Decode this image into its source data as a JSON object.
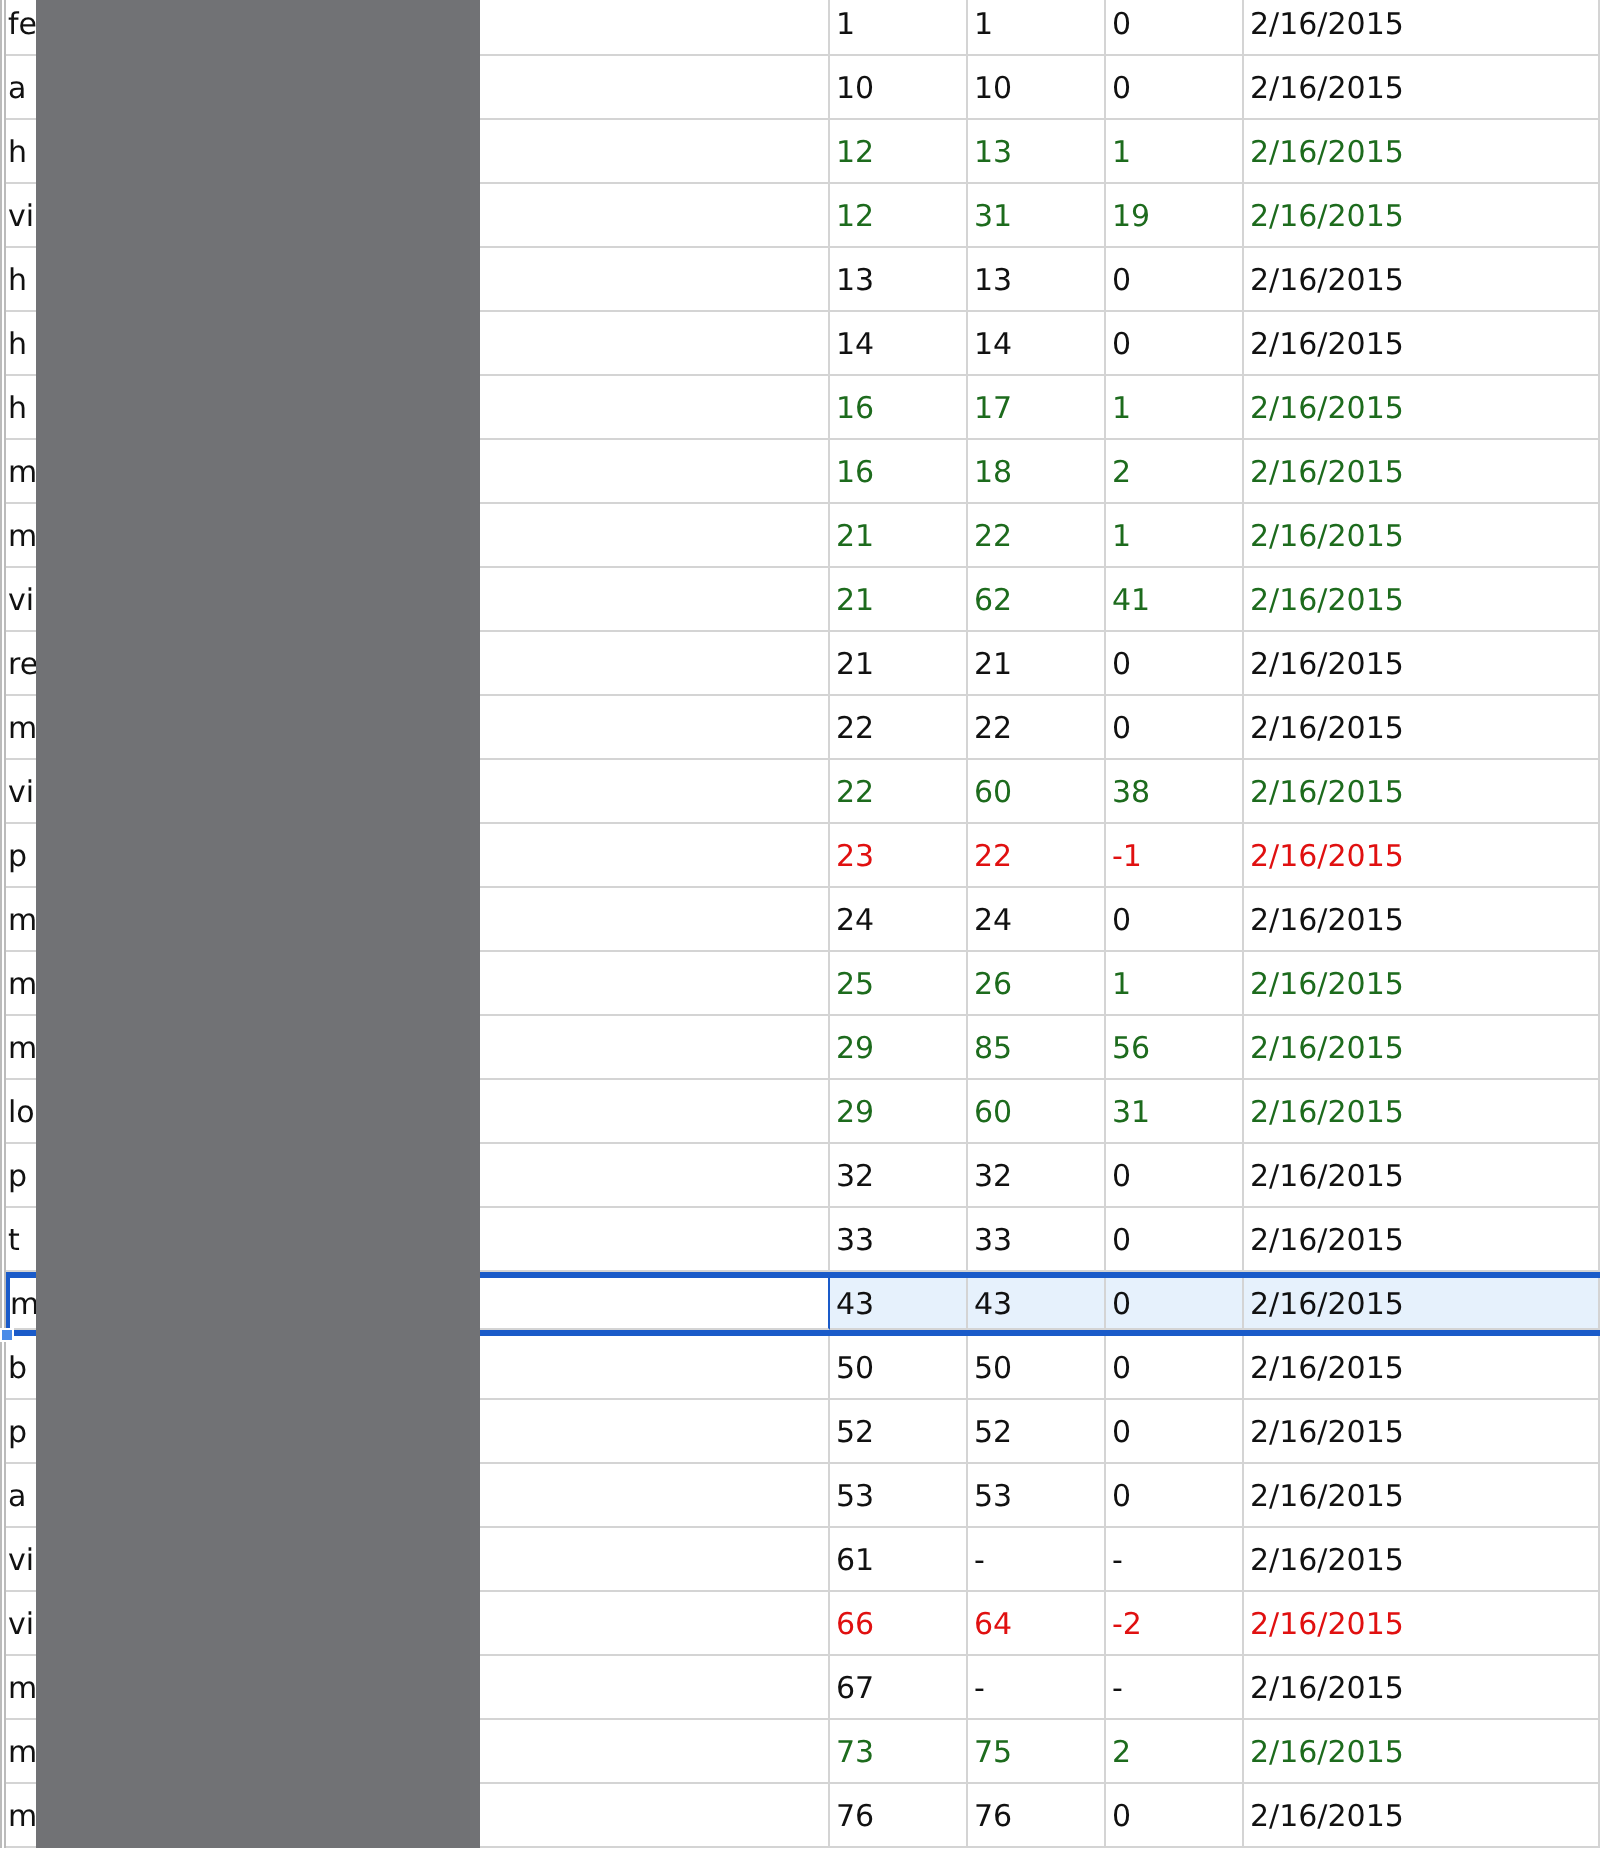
{
  "rows": [
    {
      "label": "fe",
      "column_2": "1",
      "column_3": "1",
      "column_4": "0",
      "column_5": "2/16/2015",
      "color": "#111111",
      "selected": false
    },
    {
      "label": "a",
      "column_2": "10",
      "column_3": "10",
      "column_4": "0",
      "column_5": "2/16/2015",
      "color": "#111111",
      "selected": false
    },
    {
      "label": "h",
      "column_2": "12",
      "column_3": "13",
      "column_4": "1",
      "column_5": "2/16/2015",
      "color": "#1d6b1d",
      "selected": false
    },
    {
      "label": "vi",
      "column_2": "12",
      "column_3": "31",
      "column_4": "19",
      "column_5": "2/16/2015",
      "color": "#1d6b1d",
      "selected": false
    },
    {
      "label": "h",
      "column_2": "13",
      "column_3": "13",
      "column_4": "0",
      "column_5": "2/16/2015",
      "color": "#111111",
      "selected": false
    },
    {
      "label": "h",
      "column_2": "14",
      "column_3": "14",
      "column_4": "0",
      "column_5": "2/16/2015",
      "color": "#111111",
      "selected": false
    },
    {
      "label": "h",
      "column_2": "16",
      "column_3": "17",
      "column_4": "1",
      "column_5": "2/16/2015",
      "color": "#1d6b1d",
      "selected": false
    },
    {
      "label": "m",
      "column_2": "16",
      "column_3": "18",
      "column_4": "2",
      "column_5": "2/16/2015",
      "color": "#1d6b1d",
      "selected": false
    },
    {
      "label": "m",
      "column_2": "21",
      "column_3": "22",
      "column_4": "1",
      "column_5": "2/16/2015",
      "color": "#1d6b1d",
      "selected": false
    },
    {
      "label": "vi",
      "column_2": "21",
      "column_3": "62",
      "column_4": "41",
      "column_5": "2/16/2015",
      "color": "#1d6b1d",
      "selected": false
    },
    {
      "label": "re",
      "column_2": "21",
      "column_3": "21",
      "column_4": "0",
      "column_5": "2/16/2015",
      "color": "#111111",
      "selected": false
    },
    {
      "label": "m",
      "column_2": "22",
      "column_3": "22",
      "column_4": "0",
      "column_5": "2/16/2015",
      "color": "#111111",
      "selected": false
    },
    {
      "label": "vi",
      "column_2": "22",
      "column_3": "60",
      "column_4": "38",
      "column_5": "2/16/2015",
      "color": "#1d6b1d",
      "selected": false
    },
    {
      "label": "p",
      "column_2": "23",
      "column_3": "22",
      "column_4": "-1",
      "column_5": "2/16/2015",
      "color": "#e01010",
      "selected": false
    },
    {
      "label": "m",
      "column_2": "24",
      "column_3": "24",
      "column_4": "0",
      "column_5": "2/16/2015",
      "color": "#111111",
      "selected": false
    },
    {
      "label": "m",
      "column_2": "25",
      "column_3": "26",
      "column_4": "1",
      "column_5": "2/16/2015",
      "color": "#1d6b1d",
      "selected": false
    },
    {
      "label": "m",
      "column_2": "29",
      "column_3": "85",
      "column_4": "56",
      "column_5": "2/16/2015",
      "color": "#1d6b1d",
      "selected": false
    },
    {
      "label": "lo",
      "column_2": "29",
      "column_3": "60",
      "column_4": "31",
      "column_5": "2/16/2015",
      "color": "#1d6b1d",
      "selected": false
    },
    {
      "label": "p",
      "column_2": "32",
      "column_3": "32",
      "column_4": "0",
      "column_5": "2/16/2015",
      "color": "#111111",
      "selected": false
    },
    {
      "label": "t",
      "column_2": "33",
      "column_3": "33",
      "column_4": "0",
      "column_5": "2/16/2015",
      "color": "#111111",
      "selected": false
    },
    {
      "label": "m",
      "column_2": "43",
      "column_3": "43",
      "column_4": "0",
      "column_5": "2/16/2015",
      "color": "#111111",
      "selected": true
    },
    {
      "label": "b",
      "column_2": "50",
      "column_3": "50",
      "column_4": "0",
      "column_5": "2/16/2015",
      "color": "#111111",
      "selected": false
    },
    {
      "label": "p",
      "column_2": "52",
      "column_3": "52",
      "column_4": "0",
      "column_5": "2/16/2015",
      "color": "#111111",
      "selected": false
    },
    {
      "label": "a",
      "column_2": "53",
      "column_3": "53",
      "column_4": "0",
      "column_5": "2/16/2015",
      "color": "#111111",
      "selected": false
    },
    {
      "label": "vi",
      "column_2": "61",
      "column_3": "-",
      "column_4": "-",
      "column_5": "2/16/2015",
      "color": "#111111",
      "selected": false
    },
    {
      "label": "vi",
      "column_2": "66",
      "column_3": "64",
      "column_4": "-2",
      "column_5": "2/16/2015",
      "color": "#e01010",
      "selected": false
    },
    {
      "label": "m",
      "column_2": "67",
      "column_3": "-",
      "column_4": "-",
      "column_5": "2/16/2015",
      "color": "#111111",
      "selected": false
    },
    {
      "label": "m",
      "column_2": "73",
      "column_3": "75",
      "column_4": "2",
      "column_5": "2/16/2015",
      "color": "#1d6b1d",
      "selected": false
    },
    {
      "label": "m",
      "column_2": "76",
      "column_3": "76",
      "column_4": "0",
      "column_5": "2/16/2015",
      "color": "#111111",
      "selected": false
    }
  ]
}
